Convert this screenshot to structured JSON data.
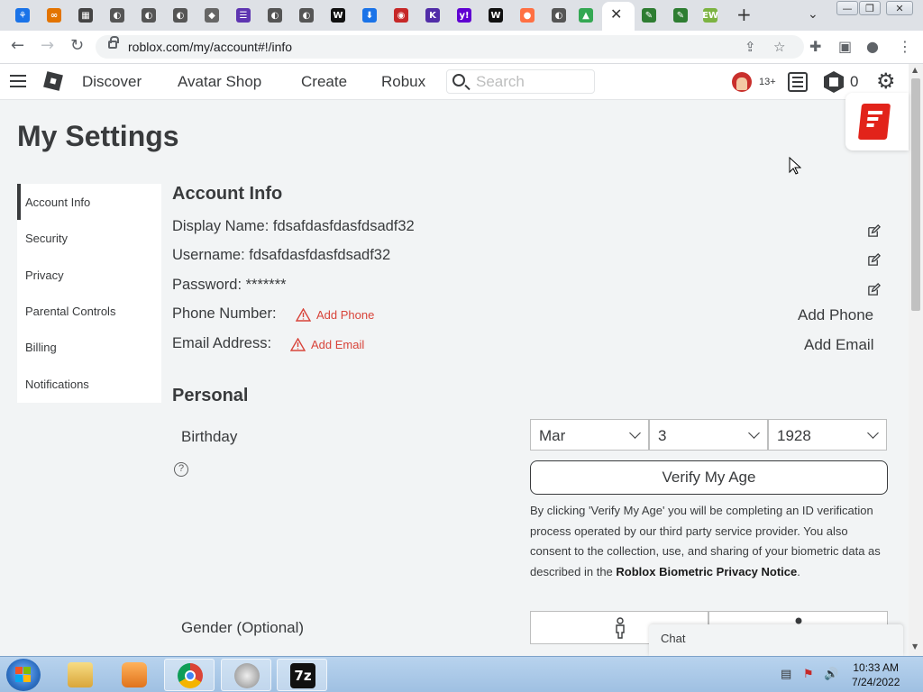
{
  "browser": {
    "tab_favicons": [
      {
        "name": "tab-favicon-1",
        "glyph": "⚘",
        "color": "#1a73e8"
      },
      {
        "name": "tab-favicon-2",
        "glyph": "∞",
        "color": "#e37400"
      },
      {
        "name": "tab-favicon-3",
        "glyph": "▦",
        "color": "#444444"
      },
      {
        "name": "tab-favicon-4",
        "glyph": "◐",
        "color": "#555555"
      },
      {
        "name": "tab-favicon-5",
        "glyph": "◐",
        "color": "#555555"
      },
      {
        "name": "tab-favicon-6",
        "glyph": "◐",
        "color": "#555555"
      },
      {
        "name": "tab-favicon-7",
        "glyph": "◆",
        "color": "#666666"
      },
      {
        "name": "tab-favicon-8",
        "glyph": "☰",
        "color": "#5e35b1"
      },
      {
        "name": "tab-favicon-9",
        "glyph": "◐",
        "color": "#555555"
      },
      {
        "name": "tab-favicon-10",
        "glyph": "◐",
        "color": "#555555"
      },
      {
        "name": "tab-favicon-11",
        "glyph": "W",
        "color": "#111111"
      },
      {
        "name": "tab-favicon-12",
        "glyph": "⬇",
        "color": "#1a73e8"
      },
      {
        "name": "tab-favicon-13",
        "glyph": "◉",
        "color": "#c62828"
      },
      {
        "name": "tab-favicon-14",
        "glyph": "K",
        "color": "#512da8"
      },
      {
        "name": "tab-favicon-15",
        "glyph": "y!",
        "color": "#6001d2"
      },
      {
        "name": "tab-favicon-16",
        "glyph": "W",
        "color": "#111111"
      },
      {
        "name": "tab-favicon-17",
        "glyph": "●",
        "color": "#ff7043"
      },
      {
        "name": "tab-favicon-18",
        "glyph": "◐",
        "color": "#555555"
      },
      {
        "name": "tab-favicon-19",
        "glyph": "▲",
        "color": "#34a853"
      },
      {
        "name": "tab-favicon-21",
        "glyph": "✎",
        "color": "#2e7d32"
      },
      {
        "name": "tab-favicon-22",
        "glyph": "✎",
        "color": "#2e7d32"
      },
      {
        "name": "tab-favicon-23",
        "glyph": "EW",
        "color": "#7cb342"
      }
    ],
    "active_tab_close": "✕",
    "new_tab": "+",
    "tab_search": "⌄",
    "window_buttons": {
      "minimize": "—",
      "maximize": "❐",
      "close": "✕"
    },
    "back": "←",
    "forward": "→",
    "reload": "↻",
    "url": "roblox.com/my/account#!/info",
    "share_icon": "⇪",
    "star_icon": "☆",
    "extensions_icon": "✚",
    "sidepanel_icon": "▣",
    "profile_icon": "●",
    "menu_icon": "⋮"
  },
  "header": {
    "nav": [
      "Discover",
      "Avatar Shop",
      "Create",
      "Robux"
    ],
    "search_placeholder": "Search",
    "age_badge": "13+",
    "robux_count": "0",
    "settings_icon": "⚙"
  },
  "page": {
    "title": "My Settings",
    "sidebar": [
      "Account Info",
      "Security",
      "Privacy",
      "Parental Controls",
      "Billing",
      "Notifications"
    ],
    "account_info": {
      "heading": "Account Info",
      "display_name": "Display Name: fdsafdasfdasfdsadf32",
      "username": "Username: fdsafdasfdasfdsadf32",
      "password": "Password: *******",
      "phone_label": "Phone Number:",
      "phone_warning": "Add Phone",
      "phone_action": "Add Phone",
      "email_label": "Email Address:",
      "email_warning": "Add Email",
      "email_action": "Add Email"
    },
    "personal": {
      "heading": "Personal",
      "birthday_label": "Birthday",
      "help_glyph": "?",
      "month": "Mar",
      "day": "3",
      "year": "1928",
      "verify_button": "Verify My Age",
      "disclaimer_text": "By clicking 'Verify My Age' you will be completing an ID verification process operated by our third party service provider. You also consent to the collection, use, and sharing of your biometric data as described in the",
      "disclaimer_link": "Roblox Biometric Privacy Notice",
      "disclaimer_end": ".",
      "gender_label": "Gender (Optional)"
    },
    "chat_label": "Chat"
  },
  "taskbar": {
    "clock_time": "10:33 AM",
    "clock_date": "7/24/2022",
    "tray_icons": [
      "▤",
      "⚑",
      "🔊"
    ],
    "seven_zip_label": "7z"
  }
}
